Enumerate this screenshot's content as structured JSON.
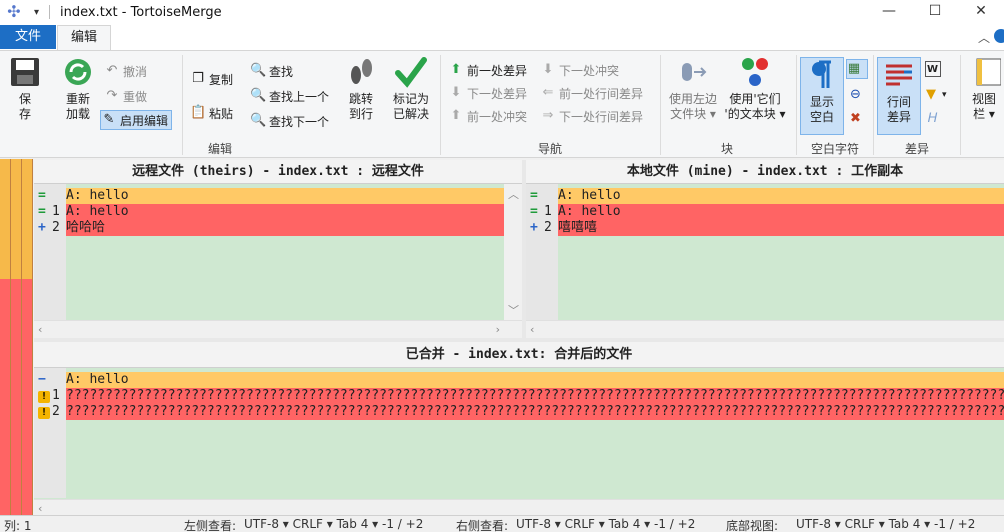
{
  "window": {
    "title": "index.txt - TortoiseMerge",
    "minimize": "—",
    "maximize": "☐",
    "close": "✕"
  },
  "ribbon_tabs": {
    "file": "文件",
    "edit": "编辑"
  },
  "ribbon": {
    "save": "保\n存",
    "reload": "重新\n加载",
    "undo": "撤消",
    "redo": "重做",
    "enable_edit": "启用编辑",
    "copy": "复制",
    "paste": "粘贴",
    "find": "查找",
    "find_prev": "查找上一个",
    "find_next": "查找下一个",
    "goto_line": "跳转\n到行",
    "mark_resolved": "标记为\n已解决",
    "group_edit": "编辑",
    "prev_diff": "前一处差异",
    "next_diff": "下一处差异",
    "prev_conflict": "前一处冲突",
    "next_conflict": "下一处冲突",
    "prev_inline_diff": "前一处行间差异",
    "next_inline_diff": "下一处行间差异",
    "group_nav": "导航",
    "use_left_block": "使用左边\n文件块 ▾",
    "use_their_block": "使用'它们\n'的文本块 ▾",
    "group_block": "块",
    "show_whitespace": "显示\n空白",
    "group_whitespace": "空白字符",
    "inline_diff": "行间\n差异",
    "group_diff": "差异",
    "view_bar": "视图\n栏 ▾"
  },
  "panes": {
    "theirs": {
      "header": "远程文件 (theirs) - index.txt : 远程文件",
      "lines": [
        {
          "mark": "=",
          "num": "",
          "text": "A: hello"
        },
        {
          "mark": "=",
          "num": "1",
          "text": "A: hello"
        },
        {
          "mark": "+",
          "num": "2",
          "text": "哈哈哈"
        }
      ]
    },
    "mine": {
      "header": "本地文件 (mine) - index.txt : 工作副本",
      "lines": [
        {
          "mark": "=",
          "num": "",
          "text": "A: hello"
        },
        {
          "mark": "=",
          "num": "1",
          "text": "A: hello"
        },
        {
          "mark": "+",
          "num": "2",
          "text": "嘻嘻嘻"
        }
      ]
    },
    "merged": {
      "header": "已合并 - index.txt: 合并后的文件",
      "lines": [
        {
          "mark": "−",
          "num": "",
          "text": "A: hello"
        },
        {
          "mark": "!",
          "num": "1",
          "text": "??????????????????????????????????????????????????????????????????????????????????????????????????????????????????????????????"
        },
        {
          "mark": "!",
          "num": "2",
          "text": "??????????????????????????????????????????????????????????????????????????????????????????????????????????????????????????????"
        }
      ]
    }
  },
  "statusbar": {
    "col": "列: 1",
    "left_view": "左侧查看:",
    "left_info": "UTF-8 ▾ CRLF ▾ Tab 4 ▾   -1 / +2",
    "right_view": "右侧查看:",
    "right_info": "UTF-8 ▾ CRLF ▾ Tab 4 ▾   -1 / +2",
    "bottom_view": "底部视图:",
    "bottom_info": "UTF-8 ▾ CRLF ▾ Tab 4 ▾   -1 / +2"
  },
  "colors": {
    "accent": "#1d6ec5",
    "unchanged_line": "#ffc966",
    "changed_line": "#ff6464",
    "empty_area": "#cfe8d1"
  }
}
